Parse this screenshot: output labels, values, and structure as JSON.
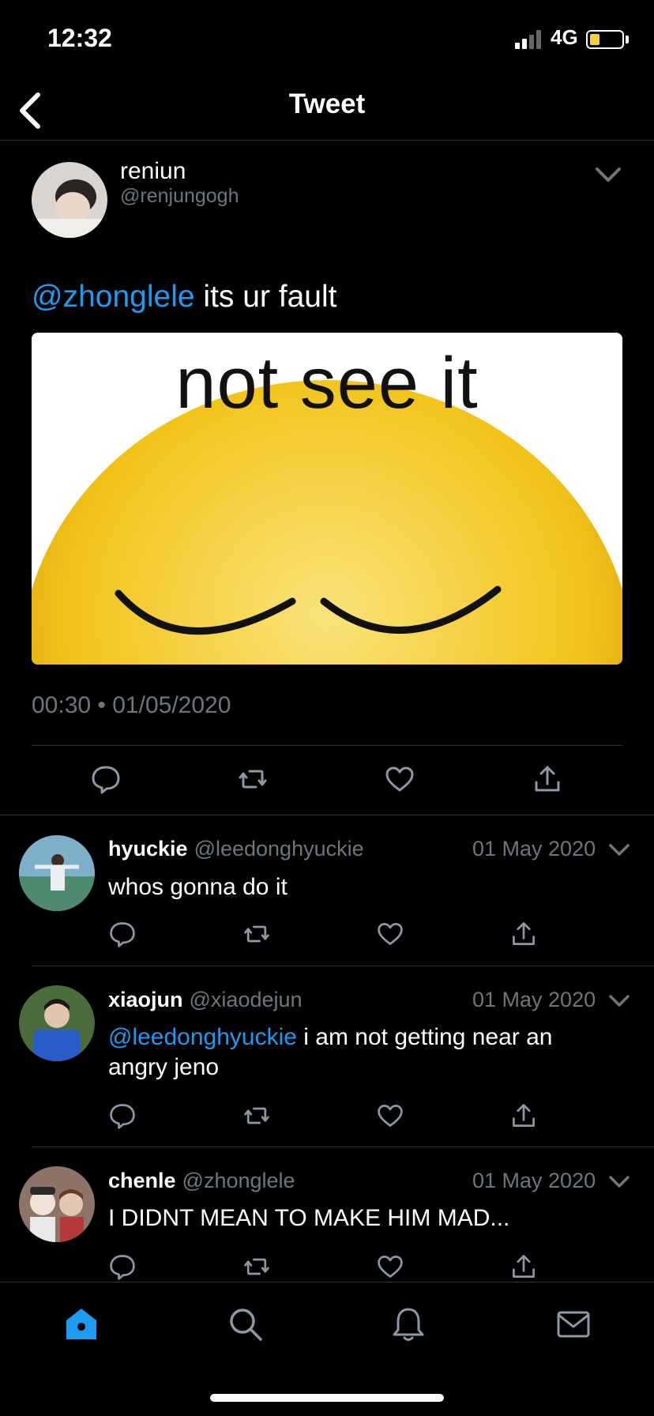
{
  "status_bar": {
    "time": "12:32",
    "network": "4G"
  },
  "header": {
    "title": "Tweet"
  },
  "tweet": {
    "author_name": "reniun",
    "author_handle": "@renjungogh",
    "mention": "@zhonglele",
    "text": " its ur fault",
    "image_caption": "not see it",
    "timestamp": "00:30 • 01/05/2020"
  },
  "replies": [
    {
      "name": "hyuckie",
      "handle": "@leedonghyuckie",
      "date": "01 May 2020",
      "mention": "",
      "text": "whos gonna do it"
    },
    {
      "name": "xiaojun",
      "handle": "@xiaodejun",
      "date": "01 May 2020",
      "mention": "@leedonghyuckie",
      "text": " i am not getting near an angry jeno"
    },
    {
      "name": "chenle",
      "handle": "@zhonglele",
      "date": "01 May 2020",
      "mention": "",
      "text": "I DIDNT MEAN TO MAKE HIM MAD..."
    }
  ],
  "tabs": [
    "home-icon",
    "search-icon",
    "notifications-icon",
    "messages-icon"
  ],
  "colors": {
    "accent": "#1d9bf0",
    "muted": "#6e767d",
    "background": "#000000",
    "emoji": "#f2c318"
  }
}
